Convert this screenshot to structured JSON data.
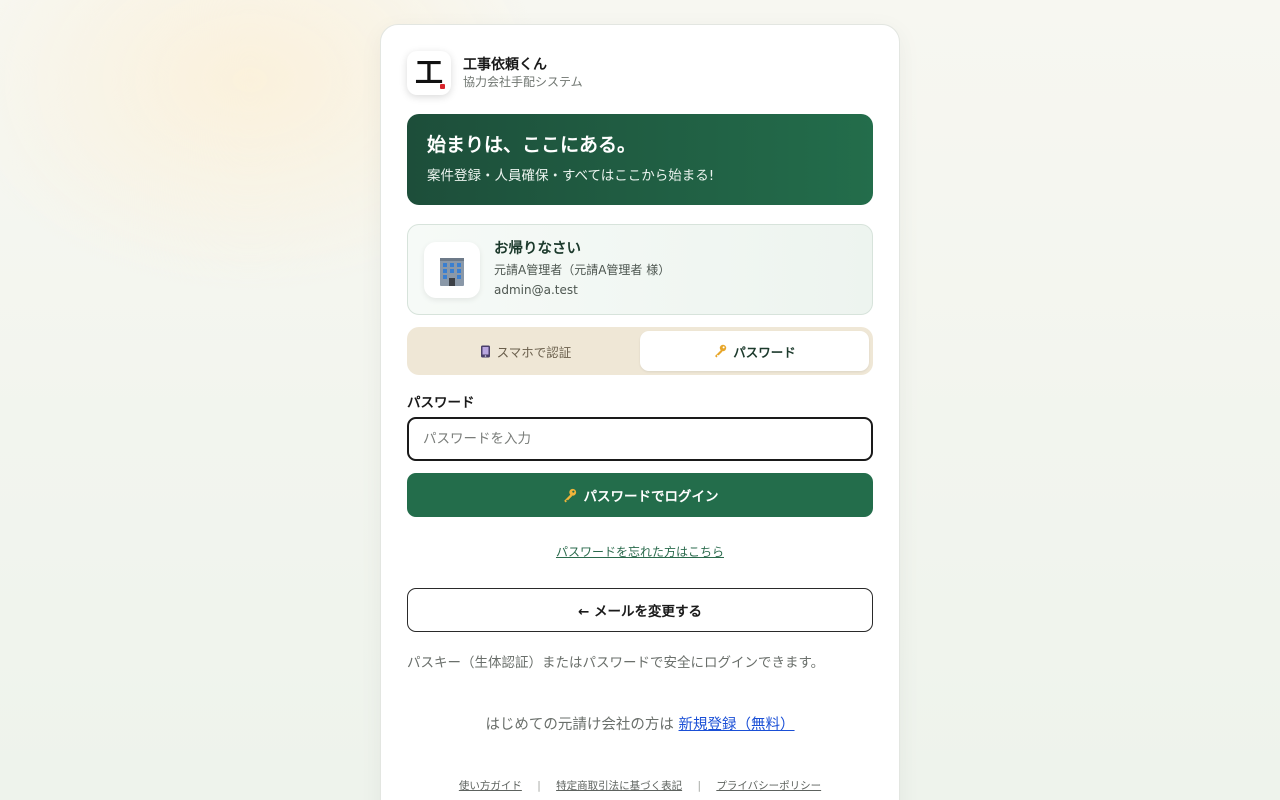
{
  "brand": {
    "logo_char": "工",
    "title": "工事依頼くん",
    "subtitle": "協力会社手配システム"
  },
  "hero": {
    "title": "始まりは、ここにある。",
    "subtitle": "案件登録・人員確保・すべてはここから始まる!"
  },
  "welcome": {
    "title": "お帰りなさい",
    "name": "元請A管理者（元請A管理者 様）",
    "email": "admin@a.test",
    "avatar_icon": "office-building-icon"
  },
  "tabs": [
    {
      "label": "スマホで認証",
      "icon": "phone-icon",
      "active": false
    },
    {
      "label": "パスワード",
      "icon": "key-icon",
      "active": true
    }
  ],
  "password_field": {
    "label": "パスワード",
    "placeholder": "パスワードを入力",
    "value": ""
  },
  "login_button": {
    "label": "パスワードでログイン",
    "icon": "key-icon"
  },
  "forgot_link": "パスワードを忘れた方はこちら",
  "change_email_button": "← メールを変更する",
  "note": "パスキー（生体認証）またはパスワードで安全にログインできます。",
  "signup": {
    "prefix": "はじめての元請け会社の方は",
    "link": "新規登録（無料）"
  },
  "footer": {
    "links": [
      "使い方ガイド",
      "特定商取引法に基づく表記",
      "プライバシーポリシー"
    ]
  },
  "colors": {
    "brand_green": "#236d4b",
    "hero_dark": "#1d4e3a",
    "tab_bg": "#efe7d6",
    "link_blue": "#1a4fd6"
  }
}
